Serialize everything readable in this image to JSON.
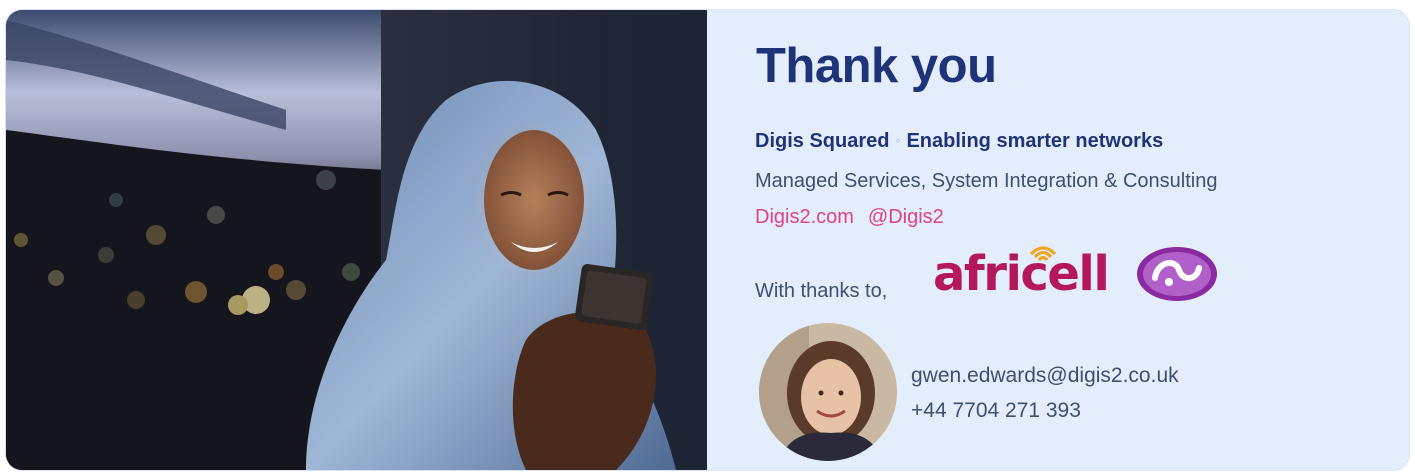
{
  "heading": "Thank you",
  "company": {
    "name": "Digis Squared",
    "separator": "◦",
    "tagline": "Enabling smarter networks",
    "services": "Managed Services, System Integration & Consulting",
    "website": "Digis2.com",
    "handle": "@Digis2"
  },
  "thanks": {
    "label": "With thanks to,",
    "partners": [
      {
        "name": "africell",
        "icon": "africell-logo",
        "color": "#b4185a"
      },
      {
        "name": "SL",
        "icon": "purple-oval-logo",
        "color": "#8a2aa0"
      }
    ]
  },
  "contact": {
    "email": "gwen.edwards@digis2.co.uk",
    "phone": "+44 7704 271 393",
    "avatar_icon": "person-portrait"
  },
  "colors": {
    "heading": "#1f3478",
    "link": "#e0418b",
    "panel_background": "#e3edfb"
  },
  "photo": {
    "icon": "woman-with-phone-photo"
  }
}
